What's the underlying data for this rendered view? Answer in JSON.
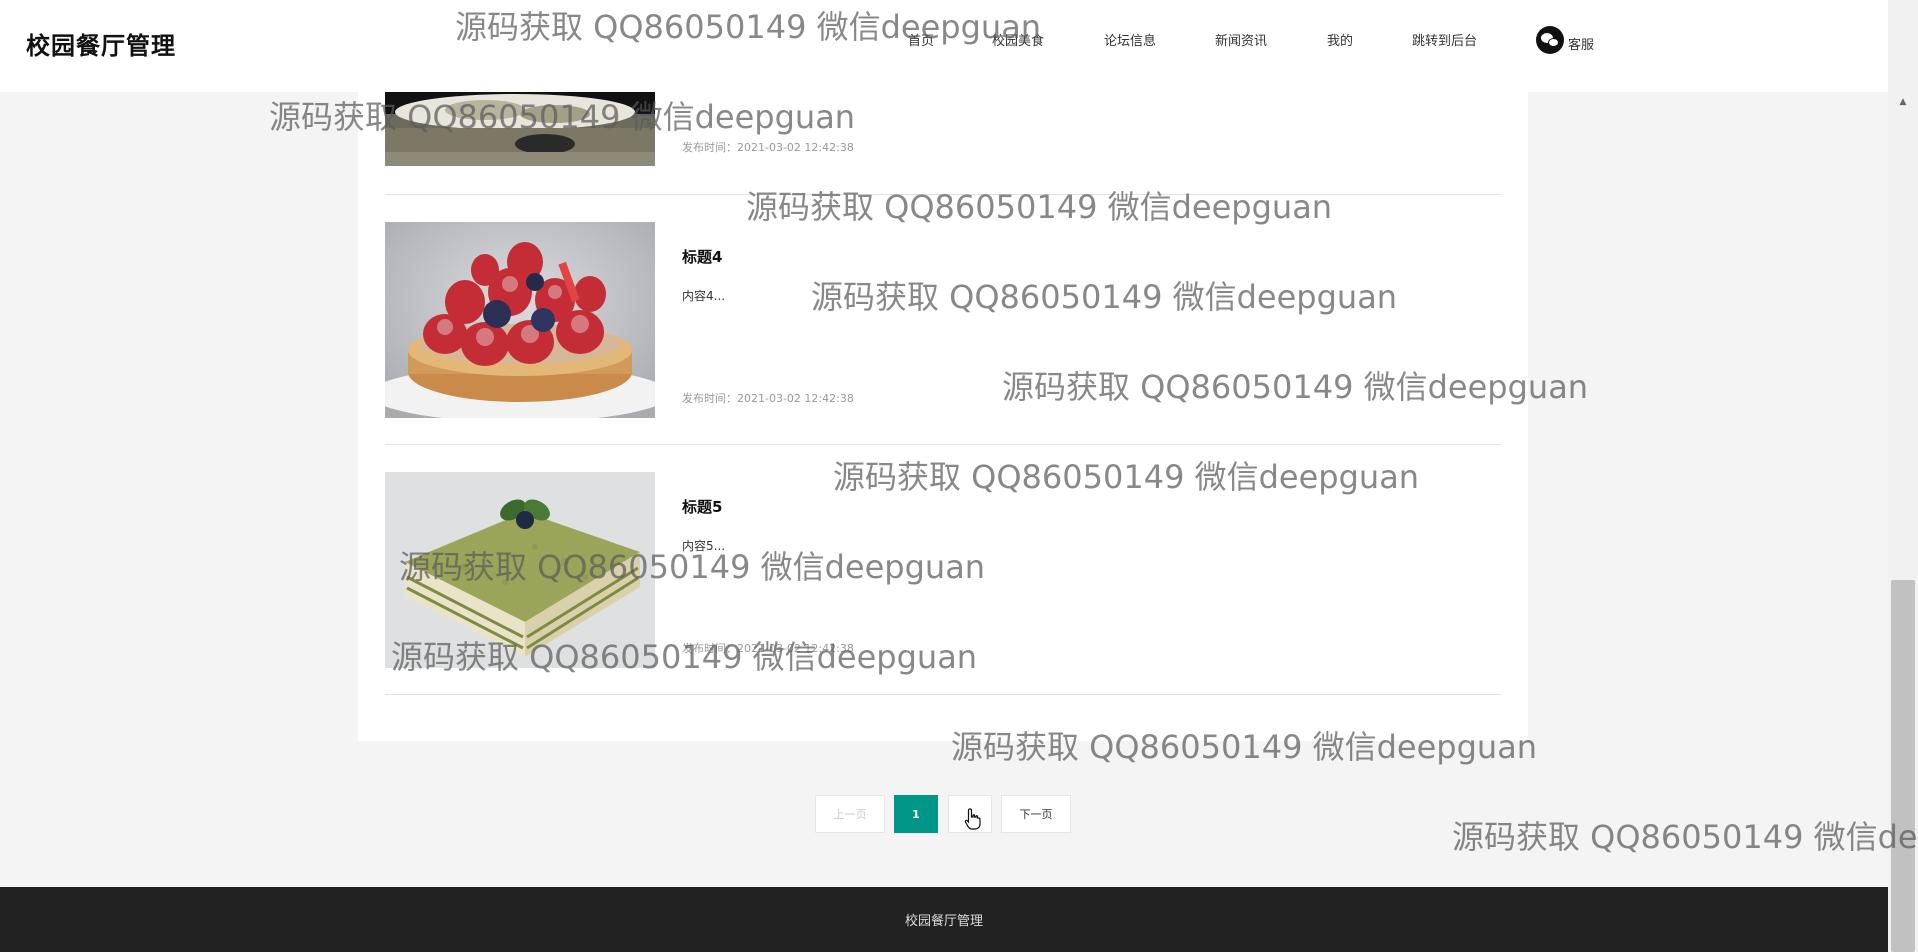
{
  "header": {
    "brand": "校园餐厅管理",
    "nav": [
      {
        "label": "首页",
        "name": "nav-home"
      },
      {
        "label": "校园美食",
        "name": "nav-campus-food"
      },
      {
        "label": "论坛信息",
        "name": "nav-forum"
      },
      {
        "label": "新闻资讯",
        "name": "nav-news"
      },
      {
        "label": "我的",
        "name": "nav-mine"
      },
      {
        "label": "跳转到后台",
        "name": "nav-admin"
      }
    ],
    "service_label": "客服",
    "service_icon": "wechat-icon"
  },
  "items": [
    {
      "title": "",
      "content": "",
      "time": "发布时间：2021-03-02 12:42:38"
    },
    {
      "title": "标题4",
      "content": "内容4...",
      "time": "发布时间：2021-03-02 12:42:38"
    },
    {
      "title": "标题5",
      "content": "内容5...",
      "time": "发布时间：2021-03-02 12:42:38"
    }
  ],
  "pagination": {
    "prev": "上一页",
    "current": "1",
    "blank": "",
    "next": "下一页"
  },
  "footer": {
    "text": "校园餐厅管理"
  },
  "watermark": "源码获取 QQ86050149 微信deepguan",
  "colors": {
    "accent": "#009688",
    "footer_bg": "#222222",
    "page_bg": "#f4f4f4"
  }
}
